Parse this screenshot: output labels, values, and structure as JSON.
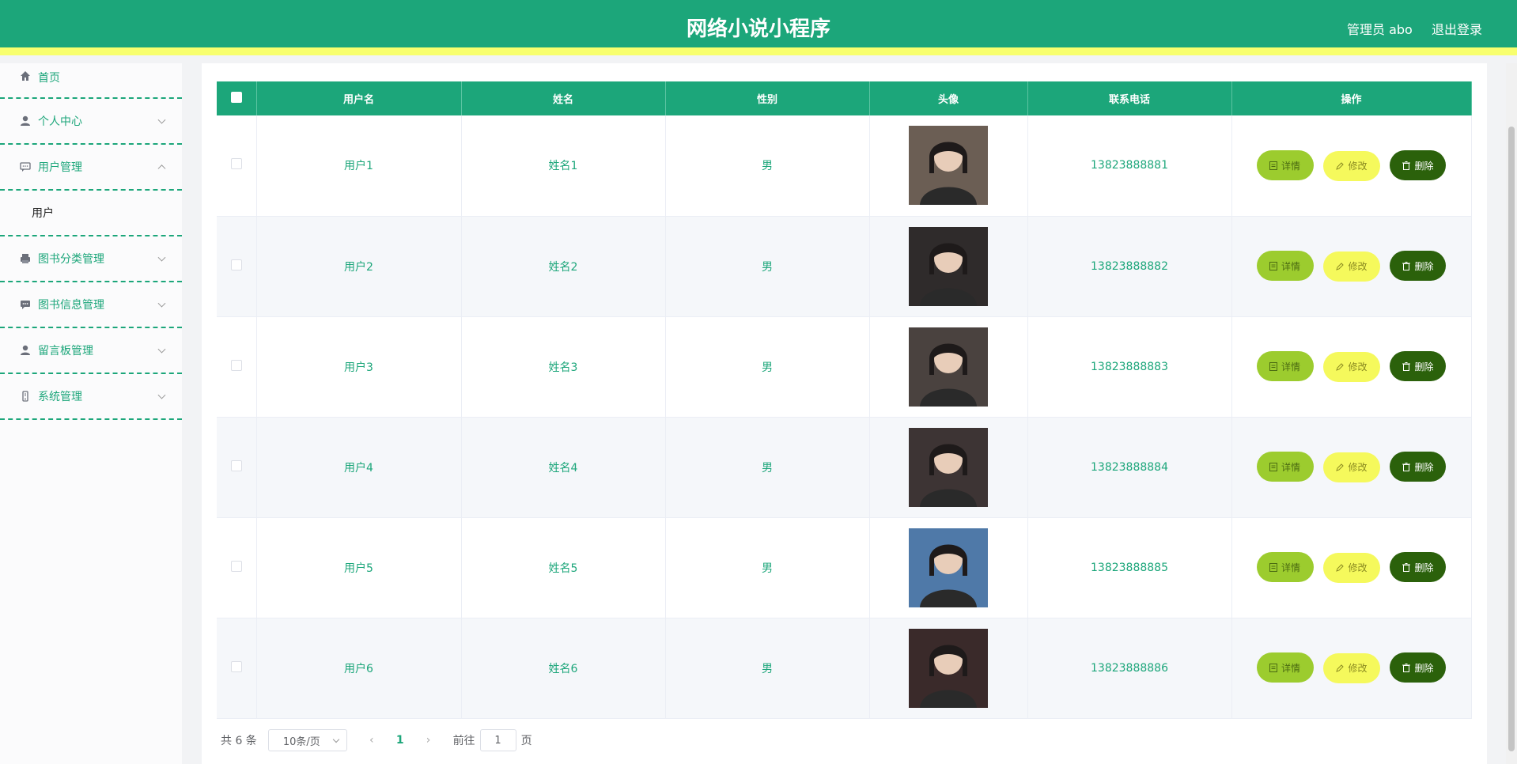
{
  "header": {
    "title": "网络小说小程序",
    "admin_label": "管理员 abo",
    "logout_label": "退出登录"
  },
  "sidebar": {
    "items": [
      {
        "label": "首页",
        "icon": "home-icon"
      },
      {
        "label": "个人中心",
        "icon": "user-icon"
      },
      {
        "label": "用户管理",
        "icon": "chat-icon",
        "expanded": true,
        "children": [
          {
            "label": "用户"
          }
        ]
      },
      {
        "label": "图书分类管理",
        "icon": "printer-icon"
      },
      {
        "label": "图书信息管理",
        "icon": "message-icon"
      },
      {
        "label": "留言板管理",
        "icon": "user-icon"
      },
      {
        "label": "系统管理",
        "icon": "phone-icon"
      }
    ]
  },
  "table": {
    "columns": [
      "用户名",
      "姓名",
      "性别",
      "头像",
      "联系电话",
      "操作"
    ],
    "rows": [
      {
        "username": "用户1",
        "name": "姓名1",
        "gender": "男",
        "phone": "13823888881",
        "avatar_color": "#6b5e54"
      },
      {
        "username": "用户2",
        "name": "姓名2",
        "gender": "男",
        "phone": "13823888882",
        "avatar_color": "#2f2b2b"
      },
      {
        "username": "用户3",
        "name": "姓名3",
        "gender": "男",
        "phone": "13823888883",
        "avatar_color": "#4a423f"
      },
      {
        "username": "用户4",
        "name": "姓名4",
        "gender": "男",
        "phone": "13823888884",
        "avatar_color": "#3d3434"
      },
      {
        "username": "用户5",
        "name": "姓名5",
        "gender": "男",
        "phone": "13823888885",
        "avatar_color": "#4f79a8"
      },
      {
        "username": "用户6",
        "name": "姓名6",
        "gender": "男",
        "phone": "13823888886",
        "avatar_color": "#3a2a2a"
      }
    ],
    "actions": {
      "detail": "详情",
      "edit": "修改",
      "delete": "删除"
    }
  },
  "pagination": {
    "total": "共 6 条",
    "page_size": "10条/页",
    "current_page": "1",
    "goto_label": "前往",
    "goto_value": "1",
    "page_suffix": "页"
  },
  "colors": {
    "primary": "#1ca67a",
    "accent_yellow": "#f8ff6e",
    "detail_button": "#9ccc2e",
    "edit_button": "#f5f95c",
    "delete_button": "#2b610b"
  }
}
